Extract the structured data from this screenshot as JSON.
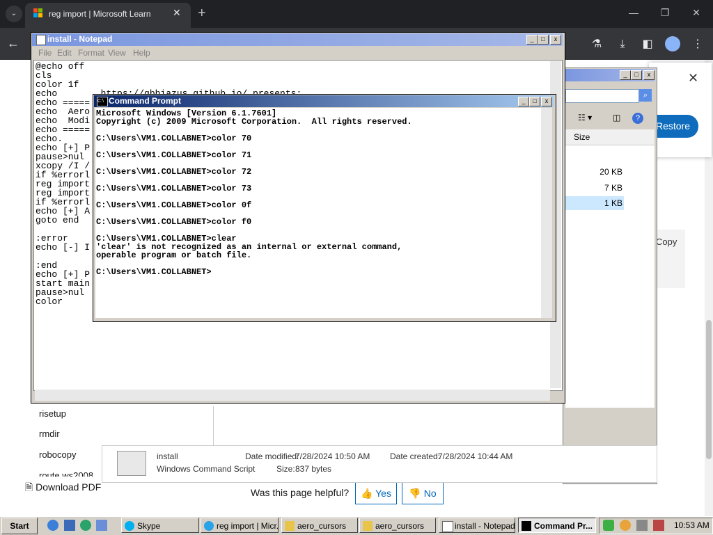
{
  "browser": {
    "tab_title": "reg import | Microsoft Learn",
    "tab_close": "✕",
    "new_tab": "+",
    "tab_menu": "⌄",
    "win_minimize": "—",
    "win_maximize": "❐",
    "win_close": "✕",
    "back": "←",
    "icons": [
      "flask-icon",
      "download-icon",
      "sidebar-icon",
      "profile-icon",
      "menu-icon"
    ]
  },
  "page": {
    "side_links": [
      "risetup",
      "rmdir",
      "robocopy",
      "route ws2008"
    ],
    "download_pdf": "Download PDF",
    "helpful_question": "Was this page helpful?",
    "yes": "Yes",
    "no": "No",
    "dialog_close": "✕",
    "restore": "Restore",
    "copy": "Copy"
  },
  "explorer": {
    "size_header": "Size",
    "sizes": [
      "20 KB",
      "7 KB",
      "1 KB"
    ],
    "detail": {
      "name": "install",
      "type": "Windows Command Script",
      "modified_label": "Date modified:",
      "modified": "7/28/2024 10:50 AM",
      "created_label": "Date created:",
      "created": "7/28/2024 10:44 AM",
      "size_label": "Size:",
      "size": "837 bytes"
    }
  },
  "notepad": {
    "title": "install - Notepad",
    "menu": [
      "File",
      "Edit",
      "Format",
      "View",
      "Help"
    ],
    "lines": [
      "@echo off",
      "cls",
      "color 1f",
      "echo        https://gbbiazus.github.io/ presents:",
      "echo =====",
      "echo  Aero",
      "echo  Modi",
      "echo =====",
      "echo.",
      "echo [+] P",
      "pause>nul",
      "xcopy /I /",
      "if %errorl",
      "reg import",
      "reg import",
      "if %errorl",
      "echo [+] A",
      "goto end",
      "",
      ":error",
      "echo [-] I",
      "",
      ":end",
      "echo [+] P",
      "start main",
      "pause>nul",
      "color"
    ]
  },
  "cmd": {
    "title": "Command Prompt",
    "lines": [
      "Microsoft Windows [Version 6.1.7601]",
      "Copyright (c) 2009 Microsoft Corporation.  All rights reserved.",
      "",
      "C:\\Users\\VM1.COLLABNET>color 70",
      "",
      "C:\\Users\\VM1.COLLABNET>color 71",
      "",
      "C:\\Users\\VM1.COLLABNET>color 72",
      "",
      "C:\\Users\\VM1.COLLABNET>color 73",
      "",
      "C:\\Users\\VM1.COLLABNET>color 0f",
      "",
      "C:\\Users\\VM1.COLLABNET>color f0",
      "",
      "C:\\Users\\VM1.COLLABNET>clear",
      "'clear' is not recognized as an internal or external command,",
      "operable program or batch file.",
      "",
      "C:\\Users\\VM1.COLLABNET>"
    ]
  },
  "taskbar": {
    "start": "Start",
    "tasks": [
      "Skype",
      "reg import | Micr...",
      "aero_cursors",
      "aero_cursors",
      "install - Notepad",
      "Command Pr..."
    ],
    "clock": "10:53 AM"
  }
}
